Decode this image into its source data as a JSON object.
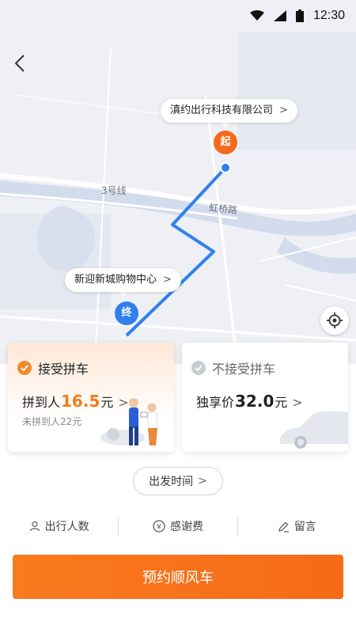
{
  "status_bar": {
    "time": "12:30"
  },
  "map": {
    "start_place": "滇约出行科技有限公司",
    "end_place": "新迎新城购物中心",
    "start_marker": "起",
    "end_marker": "终",
    "street_labels": [
      "3号线",
      "虹桥路"
    ]
  },
  "cards": {
    "accept": {
      "title": "接受拼车",
      "price_prefix": "拼到人",
      "price": "16.5",
      "price_unit": "元",
      "sub": "未拼到人22元",
      "selected": true
    },
    "reject": {
      "title": "不接受拼车",
      "price_prefix": "独享价",
      "price": "32.0",
      "price_unit": "元",
      "selected": false
    }
  },
  "depart": {
    "label": "出发时间"
  },
  "options": [
    {
      "icon": "person-icon",
      "label": "出行人数"
    },
    {
      "icon": "yen-icon",
      "label": "感谢费"
    },
    {
      "icon": "edit-icon",
      "label": "留言"
    }
  ],
  "primary_button": {
    "label": "预约顺风车"
  },
  "colors": {
    "accent": "#f5731a",
    "route": "#2f80ed"
  }
}
